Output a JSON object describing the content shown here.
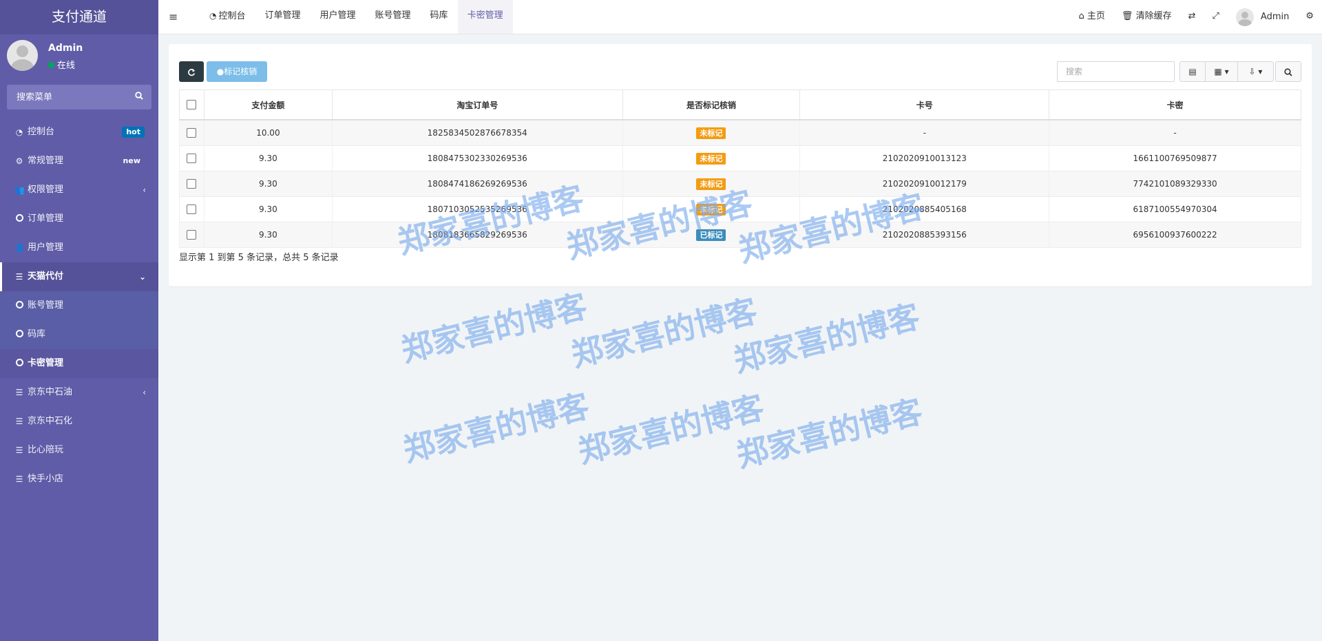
{
  "sidebar": {
    "logo": "支付通道",
    "user": {
      "name": "Admin",
      "status": "在线"
    },
    "search_placeholder": "搜索菜单",
    "menu": [
      {
        "label": "控制台",
        "badge": "hot"
      },
      {
        "label": "常规管理",
        "badge": "new"
      },
      {
        "label": "权限管理"
      },
      {
        "label": "订单管理"
      },
      {
        "label": "用户管理"
      },
      {
        "label": "天猫代付"
      },
      {
        "label": "账号管理"
      },
      {
        "label": "码库"
      },
      {
        "label": "卡密管理"
      },
      {
        "label": "京东中石油"
      },
      {
        "label": "京东中石化"
      },
      {
        "label": "比心陪玩"
      },
      {
        "label": "快手小店"
      }
    ]
  },
  "topbar": {
    "tabs": [
      "控制台",
      "订单管理",
      "用户管理",
      "账号管理",
      "码库",
      "卡密管理"
    ],
    "home": "主页",
    "clear_cache": "清除缓存",
    "user": "Admin"
  },
  "toolbar": {
    "mark_button": "标记核销",
    "search_placeholder": "搜索"
  },
  "table": {
    "headers": [
      "支付金额",
      "淘宝订单号",
      "是否标记核销",
      "卡号",
      "卡密"
    ],
    "rows": [
      {
        "amount": "10.00",
        "order": "1825834502876678354",
        "status": "未标记",
        "card": "-",
        "secret": "-"
      },
      {
        "amount": "9.30",
        "order": "1808475302330269536",
        "status": "未标记",
        "card": "2102020910013123",
        "secret": "1661100769509877"
      },
      {
        "amount": "9.30",
        "order": "1808474186269269536",
        "status": "未标记",
        "card": "2102020910012179",
        "secret": "7742101089329330"
      },
      {
        "amount": "9.30",
        "order": "1807103052535269536",
        "status": "未标记",
        "card": "2102020885405168",
        "secret": "6187100554970304"
      },
      {
        "amount": "9.30",
        "order": "1808183665829269536",
        "status": "已标记",
        "card": "2102020885393156",
        "secret": "6956100937600222"
      }
    ],
    "pagination": "显示第 1 到第 5 条记录，总共 5 条记录"
  },
  "watermark": "郑家喜的博客",
  "colors": {
    "sidebar": "#605ca8",
    "label_unmarked": "#f39c12",
    "label_marked": "#3c8dbc",
    "badge_hot": "#0073b7"
  }
}
